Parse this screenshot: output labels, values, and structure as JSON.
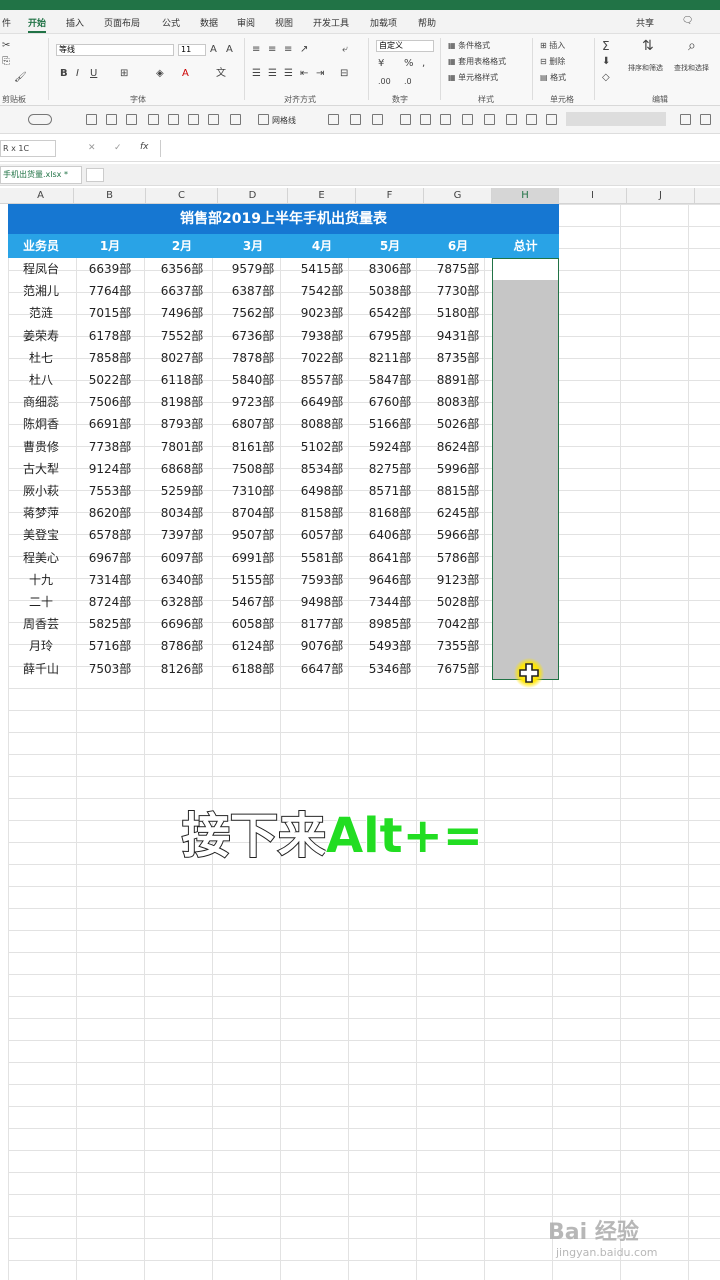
{
  "menu": {
    "tabs": [
      "件",
      "开始",
      "插入",
      "页面布局",
      "公式",
      "数据",
      "审阅",
      "视图",
      "开发工具",
      "加载项",
      "帮助"
    ],
    "share_label": "共享"
  },
  "ribbon": {
    "font_name": "等线",
    "font_size": "11",
    "number_format": "自定义",
    "conditional_format": "条件格式",
    "table_format": "套用表格格式",
    "cell_style": "单元格样式",
    "insert": "插入",
    "delete": "删除",
    "format": "格式",
    "sort_filter": "排序和筛选",
    "find_select": "查找和选择",
    "groups": {
      "clipboard": "剪贴板",
      "font": "字体",
      "alignment": "对齐方式",
      "number": "数字",
      "styles": "样式",
      "cells": "单元格",
      "editing": "编辑"
    }
  },
  "toolbar": {
    "gridlines_label": "网格线"
  },
  "formula_bar": {
    "name_box": "R x 1C",
    "fx": "fx"
  },
  "sheet_tab": {
    "label": "手机出货量.xlsx *"
  },
  "columns": [
    "A",
    "B",
    "C",
    "D",
    "E",
    "F",
    "G",
    "H",
    "I",
    "J"
  ],
  "table": {
    "title": "销售部2019上半年手机出货量表",
    "headers": [
      "业务员",
      "1月",
      "2月",
      "3月",
      "4月",
      "5月",
      "6月",
      "总计"
    ],
    "rows": [
      [
        "程凤台",
        "6639部",
        "6356部",
        "9579部",
        "5415部",
        "8306部",
        "7875部"
      ],
      [
        "范湘儿",
        "7764部",
        "6637部",
        "6387部",
        "7542部",
        "5038部",
        "7730部"
      ],
      [
        "范涟",
        "7015部",
        "7496部",
        "7562部",
        "9023部",
        "6542部",
        "5180部"
      ],
      [
        "姜荣寿",
        "6178部",
        "7552部",
        "6736部",
        "7938部",
        "6795部",
        "9431部"
      ],
      [
        "杜七",
        "7858部",
        "8027部",
        "7878部",
        "7022部",
        "8211部",
        "8735部"
      ],
      [
        "杜八",
        "5022部",
        "6118部",
        "5840部",
        "8557部",
        "5847部",
        "8891部"
      ],
      [
        "商细蕊",
        "7506部",
        "8198部",
        "9723部",
        "6649部",
        "6760部",
        "8083部"
      ],
      [
        "陈炯香",
        "6691部",
        "8793部",
        "6807部",
        "8088部",
        "5166部",
        "5026部"
      ],
      [
        "曹贵修",
        "7738部",
        "7801部",
        "8161部",
        "5102部",
        "5924部",
        "8624部"
      ],
      [
        "古大犁",
        "9124部",
        "6868部",
        "7508部",
        "8534部",
        "8275部",
        "5996部"
      ],
      [
        "厥小萩",
        "7553部",
        "5259部",
        "7310部",
        "6498部",
        "8571部",
        "8815部"
      ],
      [
        "蒋梦萍",
        "8620部",
        "8034部",
        "8704部",
        "8158部",
        "8168部",
        "6245部"
      ],
      [
        "美登宝",
        "6578部",
        "7397部",
        "9507部",
        "6057部",
        "6406部",
        "5966部"
      ],
      [
        "程美心",
        "6967部",
        "6097部",
        "6991部",
        "5581部",
        "8641部",
        "5786部"
      ],
      [
        "十九",
        "7314部",
        "6340部",
        "5155部",
        "7593部",
        "9646部",
        "9123部"
      ],
      [
        "二十",
        "8724部",
        "6328部",
        "5467部",
        "9498部",
        "7344部",
        "5028部"
      ],
      [
        "周香芸",
        "5825部",
        "6696部",
        "6058部",
        "8177部",
        "8985部",
        "7042部"
      ],
      [
        "月玲",
        "5716部",
        "8786部",
        "6124部",
        "9076部",
        "5493部",
        "7355部"
      ],
      [
        "薛千山",
        "7503部",
        "8126部",
        "6188部",
        "6647部",
        "5346部",
        "7675部"
      ]
    ]
  },
  "caption": {
    "part1": "接下来",
    "part2": "Alt+="
  },
  "watermark": {
    "brand": "Bai 经验",
    "url": "jingyan.baidu.com"
  }
}
